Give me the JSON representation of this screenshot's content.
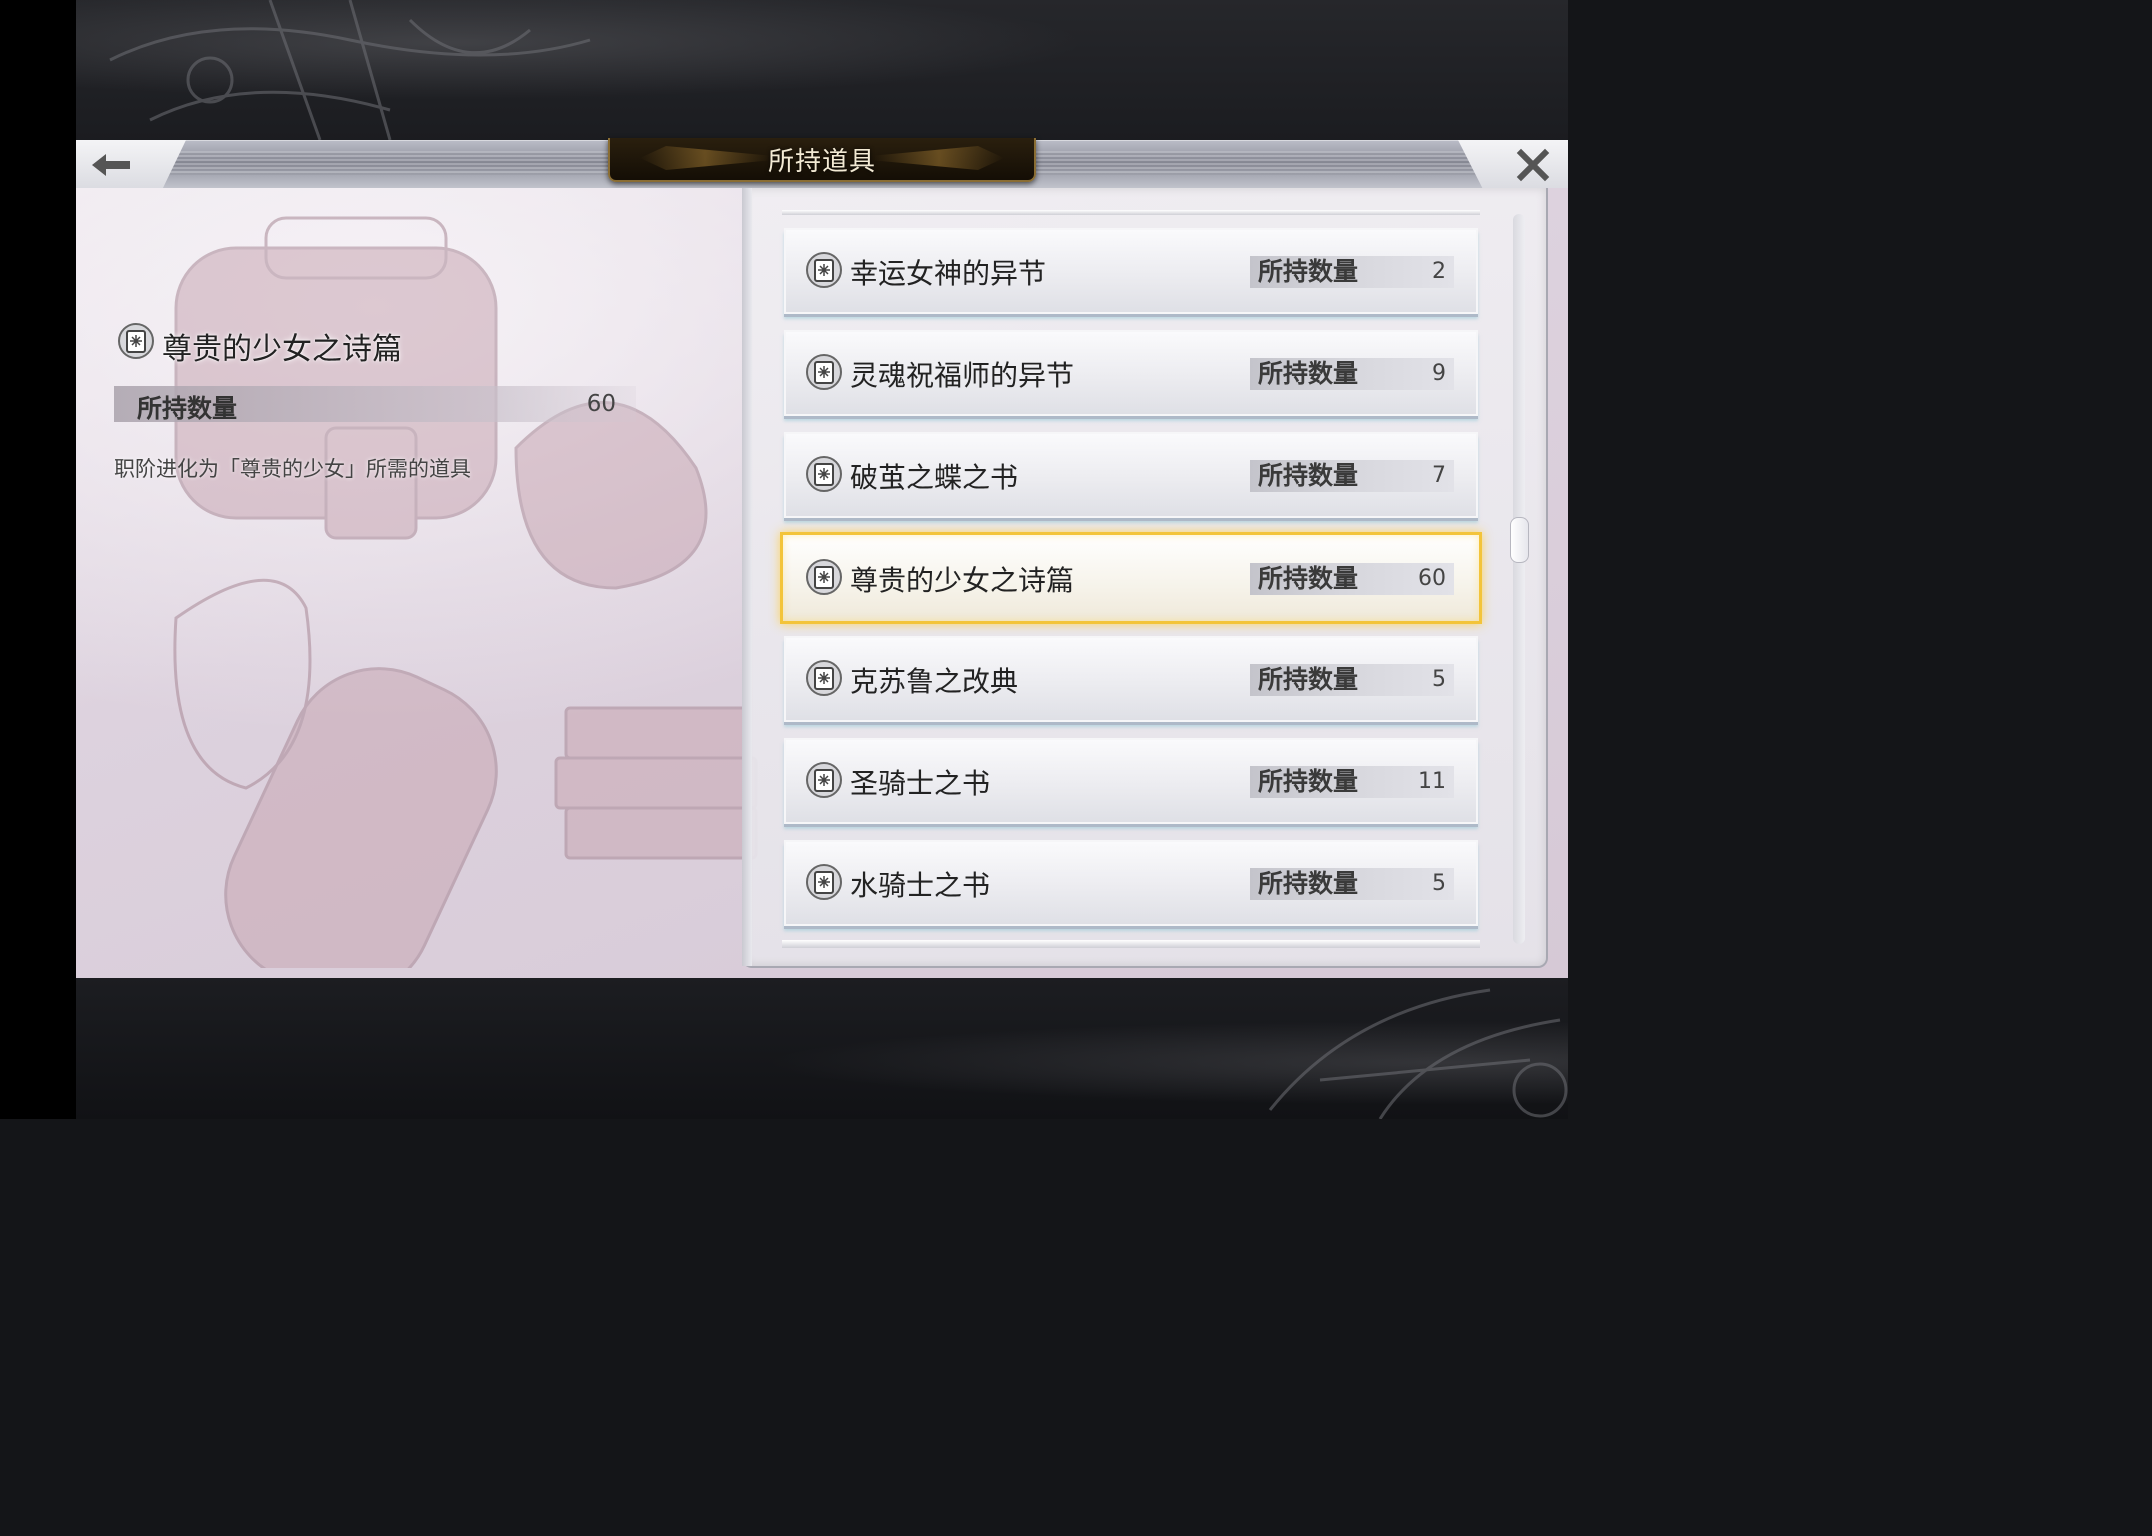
{
  "header": {
    "title": "所持道具",
    "back_icon": "back-arrow-icon",
    "close_icon": "close-x-icon"
  },
  "detail": {
    "icon": "book-icon",
    "name": "尊贵的少女之诗篇",
    "count_label": "所持数量",
    "count_value": "60",
    "description": "职阶进化为「尊贵的少女」所需的道具"
  },
  "items": [
    {
      "name": "幸运女神的异节",
      "count_label": "所持数量",
      "count": "2",
      "selected": false
    },
    {
      "name": "灵魂祝福师的异节",
      "count_label": "所持数量",
      "count": "9",
      "selected": false
    },
    {
      "name": "破茧之蝶之书",
      "count_label": "所持数量",
      "count": "7",
      "selected": false
    },
    {
      "name": "尊贵的少女之诗篇",
      "count_label": "所持数量",
      "count": "60",
      "selected": true
    },
    {
      "name": "克苏鲁之改典",
      "count_label": "所持数量",
      "count": "5",
      "selected": false
    },
    {
      "name": "圣骑士之书",
      "count_label": "所持数量",
      "count": "11",
      "selected": false
    },
    {
      "name": "水骑士之书",
      "count_label": "所持数量",
      "count": "5",
      "selected": false
    }
  ],
  "colors": {
    "selected_border": "#f3c43a",
    "title_plate": "#1a1208",
    "panel_bg": "#e4dbe5"
  }
}
